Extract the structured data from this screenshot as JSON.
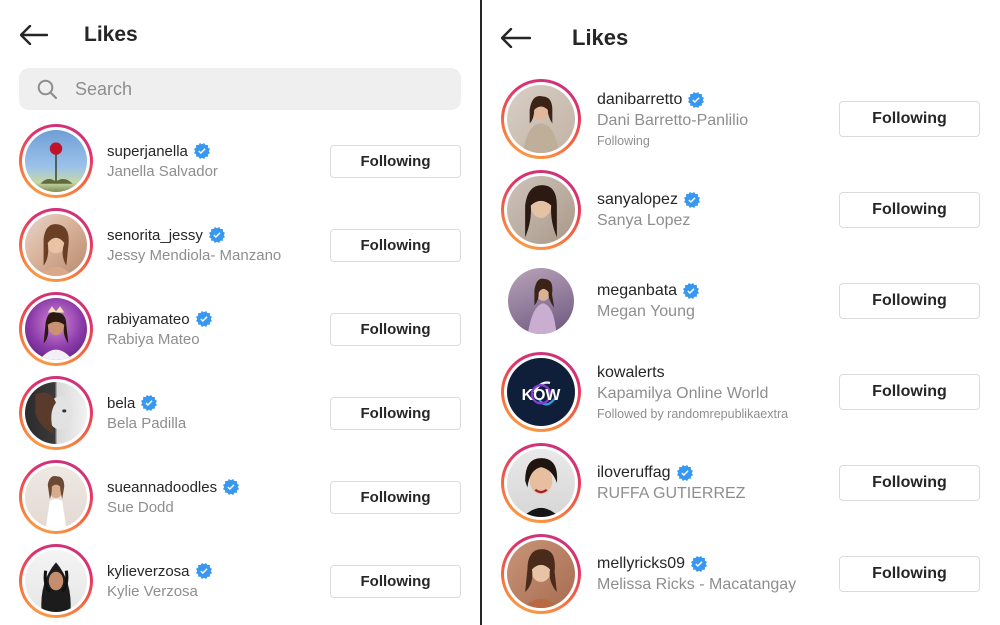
{
  "left": {
    "title": "Likes",
    "search": {
      "placeholder": "Search"
    },
    "button_label": "Following",
    "users": [
      {
        "username": "superjanella",
        "fullname": "Janella Salvador",
        "verified": true
      },
      {
        "username": "senorita_jessy",
        "fullname": "Jessy Mendiola- Manzano",
        "verified": true
      },
      {
        "username": "rabiyamateo",
        "fullname": "Rabiya Mateo",
        "verified": true
      },
      {
        "username": "bela",
        "fullname": "Bela Padilla",
        "verified": true
      },
      {
        "username": "sueannadoodles",
        "fullname": "Sue Dodd",
        "verified": true
      },
      {
        "username": "kylieverzosa",
        "fullname": "Kylie Verzosa",
        "verified": true
      }
    ]
  },
  "right": {
    "title": "Likes",
    "button_label": "Following",
    "users": [
      {
        "username": "danibarretto",
        "fullname": "Dani Barretto-Panlilio",
        "meta": "Following",
        "verified": true
      },
      {
        "username": "sanyalopez",
        "fullname": "Sanya Lopez",
        "verified": true
      },
      {
        "username": "meganbata",
        "fullname": "Megan Young",
        "verified": true
      },
      {
        "username": "kowalerts",
        "fullname": "Kapamilya Online World",
        "meta": "Followed by randomrepublikaextra",
        "verified": false,
        "avatar_text": "KOW"
      },
      {
        "username": "iloveruffag",
        "fullname": "RUFFA GUTIERREZ",
        "verified": true
      },
      {
        "username": "mellyricks09",
        "fullname": "Melissa Ricks - Macatangay",
        "verified": true
      }
    ]
  },
  "colors": {
    "text": "#262626",
    "secondary": "#8e8e8e",
    "verified_badge": "#3897f0",
    "button_border": "#dbdbdb",
    "search_bg": "#efefef"
  },
  "icons": {
    "back": "arrow-left-icon",
    "search": "search-icon",
    "verified": "verified-badge-icon"
  }
}
